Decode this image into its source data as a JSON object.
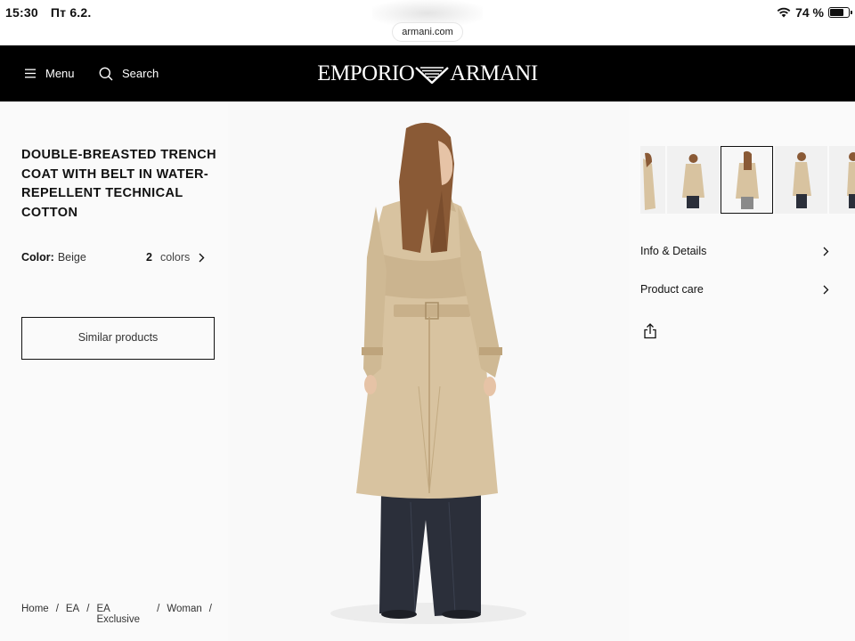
{
  "status_bar": {
    "time": "15:30",
    "date": "Пт 6.2.",
    "url": "armani.com",
    "battery": "74 %",
    "battery_level": 0.74
  },
  "header": {
    "menu_label": "Menu",
    "search_label": "Search",
    "logo_left": "EMPORIO",
    "logo_right": "ARMANI"
  },
  "product": {
    "title": "DOUBLE-BREASTED TRENCH COAT WITH BELT IN WATER-REPELLENT TECHNICAL COTTON",
    "color_label": "Color:",
    "color_value": "Beige",
    "colors_count": "2",
    "colors_label": "colors",
    "similar_button": "Similar products"
  },
  "breadcrumb": [
    "Home",
    "EA",
    "EA Exclusive",
    "Woman"
  ],
  "breadcrumb_sep": "/",
  "details": {
    "info_label": "Info & Details",
    "care_label": "Product care"
  },
  "colors": {
    "coat": "#d8c3a0",
    "jeans": "#2b2f3a",
    "hair": "#8a5a36",
    "header_bg": "#000000",
    "page_bg": "#fafafa"
  },
  "icons": [
    "menu-icon",
    "search-icon",
    "chevron-right-icon",
    "share-icon",
    "wifi-icon",
    "battery-icon"
  ]
}
